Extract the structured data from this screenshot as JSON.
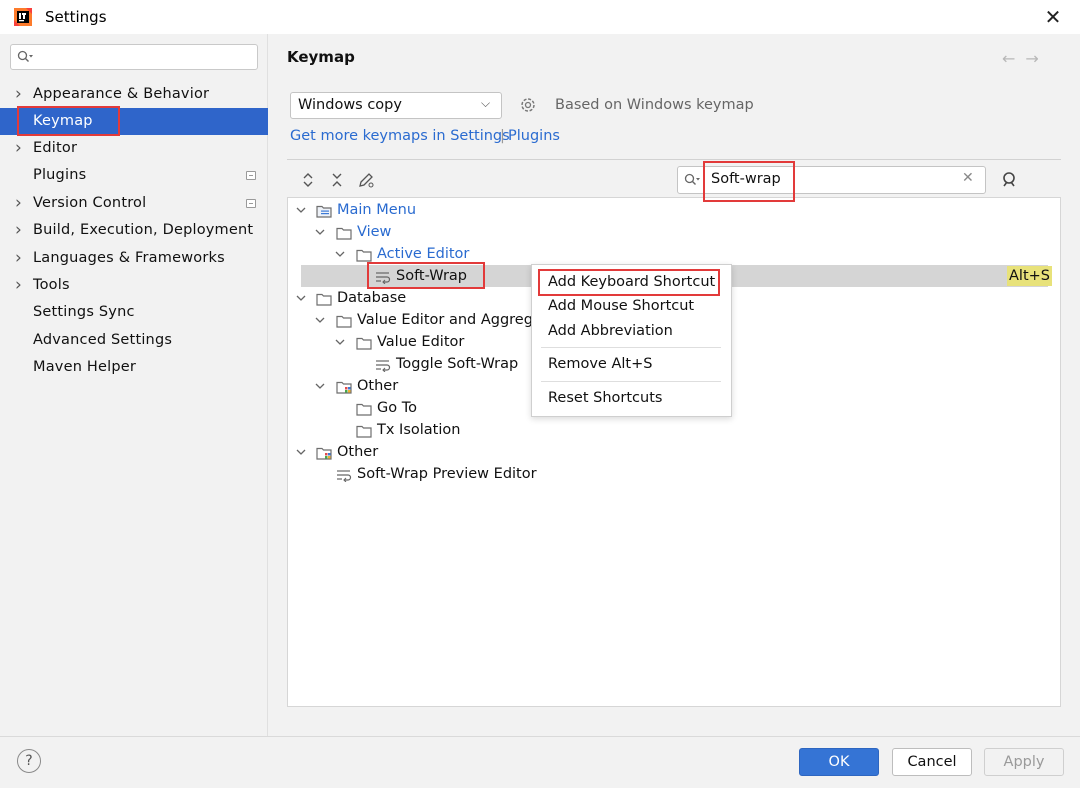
{
  "window": {
    "title": "Settings"
  },
  "sidebar": {
    "search_placeholder": "",
    "items": [
      {
        "label": "Appearance & Behavior",
        "expandable": true
      },
      {
        "label": "Keymap",
        "expandable": false,
        "selected": true
      },
      {
        "label": "Editor",
        "expandable": true
      },
      {
        "label": "Plugins",
        "expandable": false
      },
      {
        "label": "Version Control",
        "expandable": true
      },
      {
        "label": "Build, Execution, Deployment",
        "expandable": true
      },
      {
        "label": "Languages & Frameworks",
        "expandable": true
      },
      {
        "label": "Tools",
        "expandable": true
      },
      {
        "label": "Settings Sync",
        "expandable": false
      },
      {
        "label": "Advanced Settings",
        "expandable": false
      },
      {
        "label": "Maven Helper",
        "expandable": false
      }
    ]
  },
  "main": {
    "title": "Keymap",
    "keymap_select": {
      "value": "Windows copy"
    },
    "based_on": "Based on Windows keymap",
    "more_keymaps_link": "Get more keymaps in Settings",
    "separator": "|",
    "plugins_link": "Plugins",
    "search": {
      "value": "Soft-wrap"
    },
    "tree": [
      {
        "label": "Main Menu",
        "link": true
      },
      {
        "label": "View",
        "link": true
      },
      {
        "label": "Active Editor",
        "link": true
      },
      {
        "label": "Soft-Wrap",
        "shortcut": "Alt+S",
        "selected": true
      },
      {
        "label": "Database"
      },
      {
        "label": "Value Editor and Aggregat"
      },
      {
        "label": "Value Editor"
      },
      {
        "label": "Toggle Soft-Wrap"
      },
      {
        "label": "Other"
      },
      {
        "label": "Go To"
      },
      {
        "label": "Tx Isolation"
      },
      {
        "label": "Other"
      },
      {
        "label": "Soft-Wrap Preview Editor"
      }
    ]
  },
  "context_menu": {
    "items": [
      "Add Keyboard Shortcut",
      "Add Mouse Shortcut",
      "Add Abbreviation",
      "Remove Alt+S",
      "Reset Shortcuts"
    ]
  },
  "footer": {
    "help_label": "?",
    "ok_label": "OK",
    "cancel_label": "Cancel",
    "apply_label": "Apply"
  },
  "colors": {
    "selection": "#2f65ca",
    "link": "#2a6bd0",
    "highlight_box": "#e23a3a",
    "shortcut_badge": "#e8e27a",
    "primary_button": "#3574d5"
  }
}
